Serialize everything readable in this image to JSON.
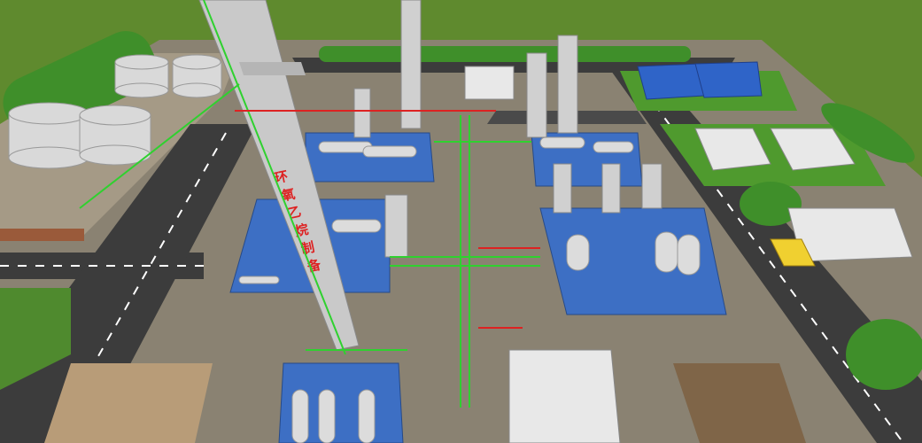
{
  "scene": {
    "tower_label": "环氧乙烷制备",
    "tower_label_chars": [
      "环",
      "氧",
      "乙",
      "烷",
      "制",
      "备"
    ],
    "colors": {
      "grass": "#5f8a2e",
      "ground": "#8a8272",
      "road": "#3c3c3c",
      "platform": "#3d6fc4",
      "pipe_green": "#2fd12f",
      "pipe_red": "#d22",
      "tank": "#d9d9d9",
      "roof_blue": "#2f64c8",
      "tree": "#3f8f2a"
    }
  }
}
